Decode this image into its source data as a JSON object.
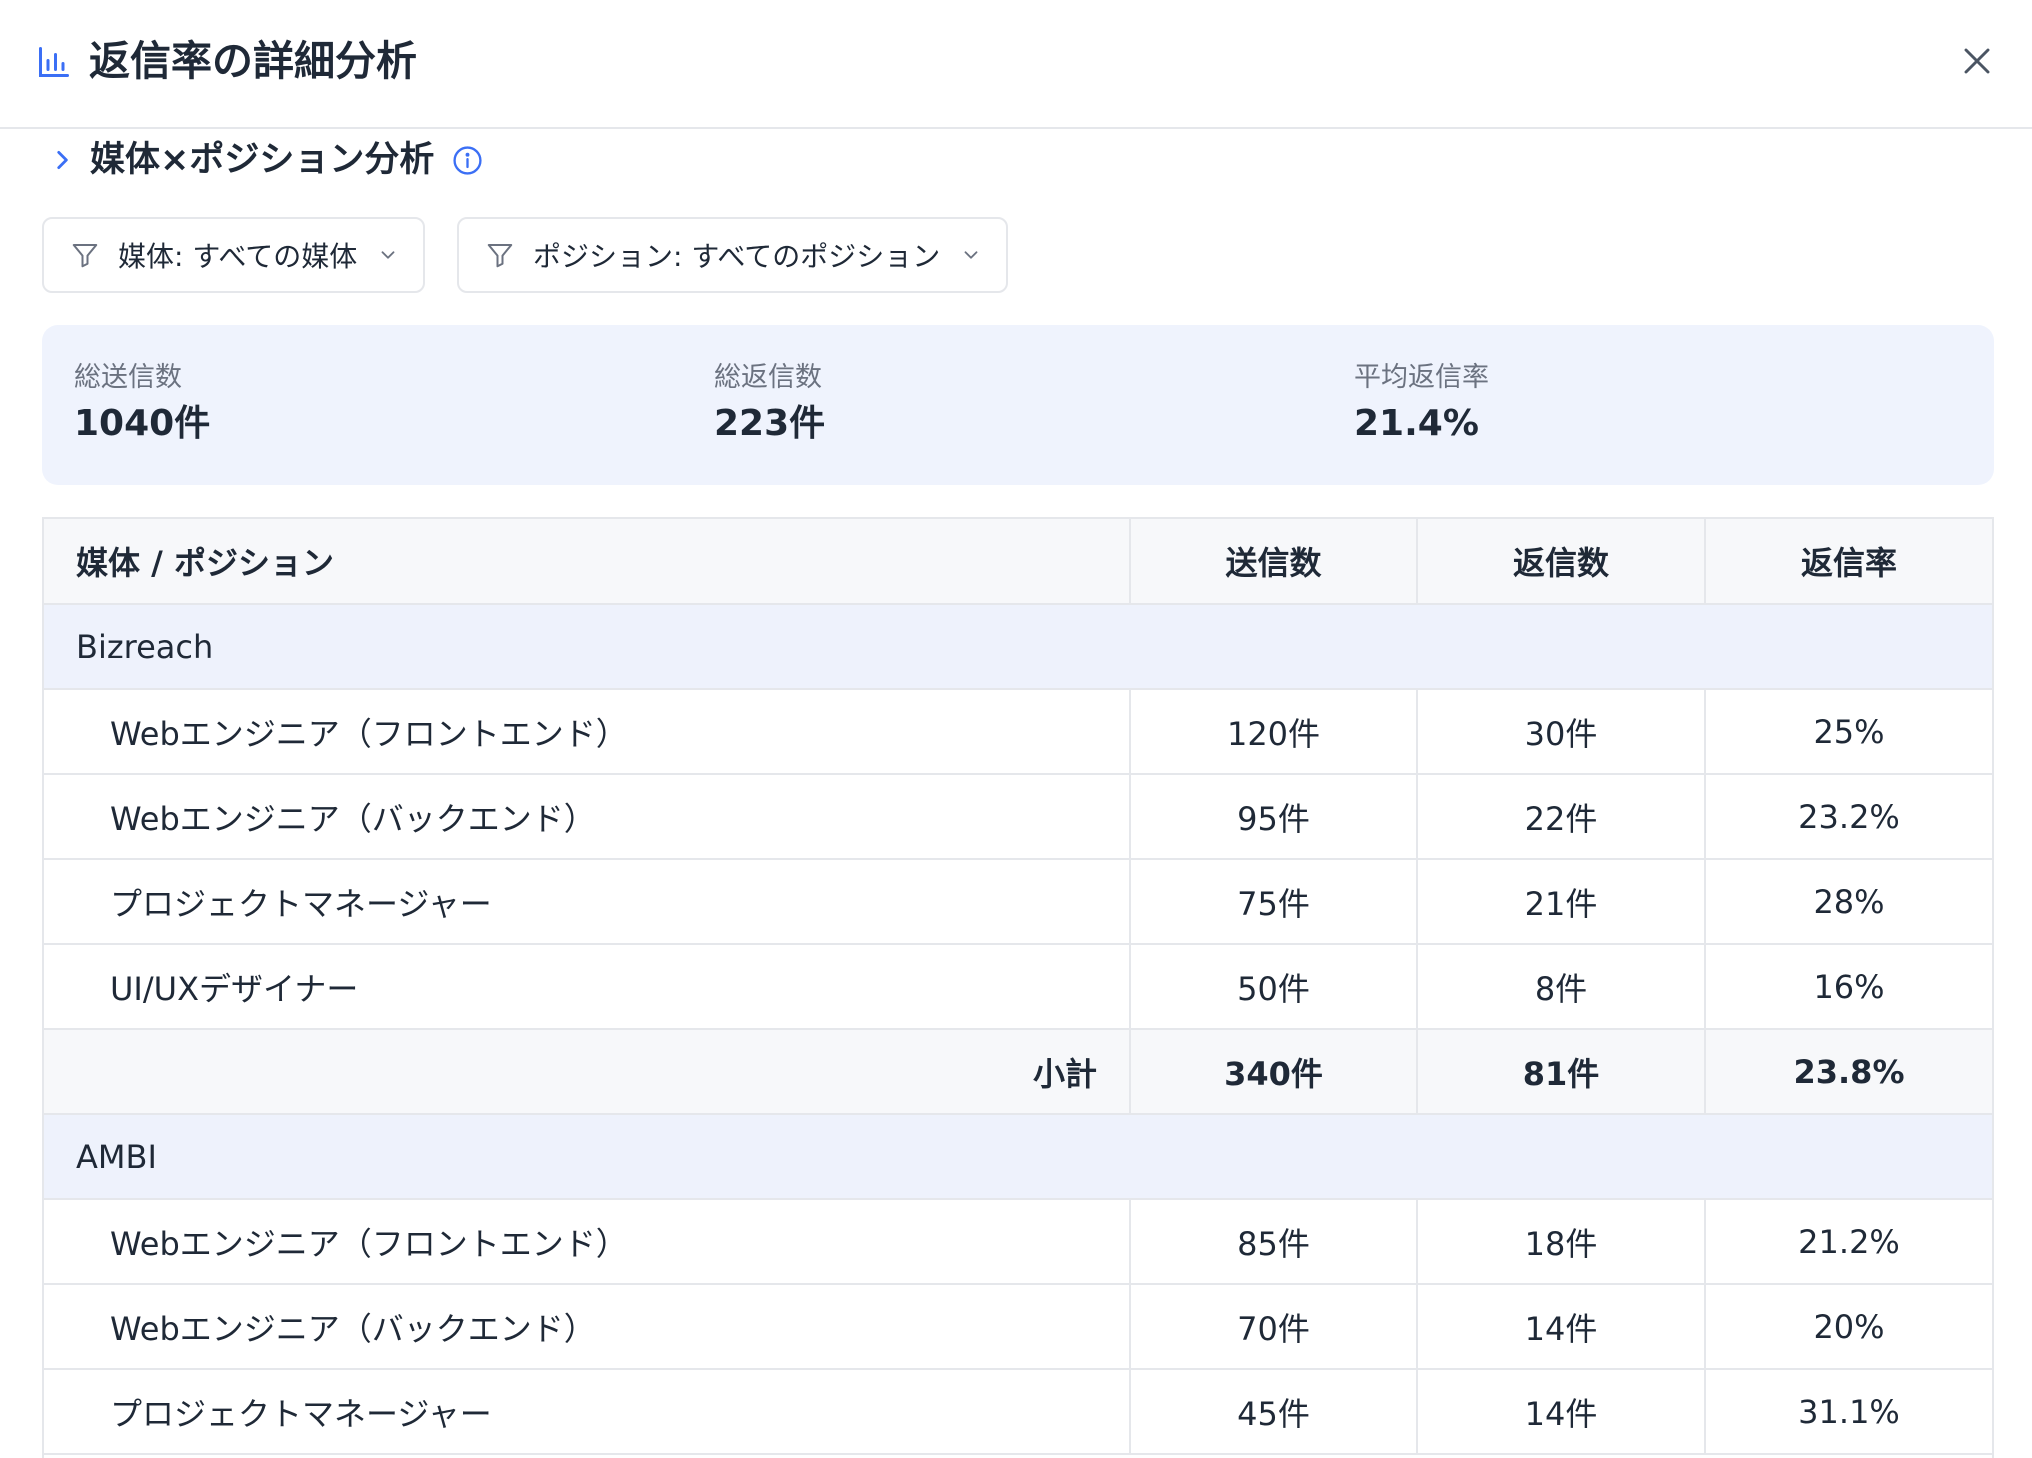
{
  "header": {
    "title": "返信率の詳細分析"
  },
  "section": {
    "title": "媒体×ポジション分析"
  },
  "filters": {
    "media": "媒体: すべての媒体",
    "position": "ポジション: すべてのポジション"
  },
  "summary": [
    {
      "label": "総送信数",
      "value": "1040件"
    },
    {
      "label": "総返信数",
      "value": "223件"
    },
    {
      "label": "平均返信率",
      "value": "21.4%"
    }
  ],
  "table": {
    "headers": [
      "媒体 / ポジション",
      "送信数",
      "返信数",
      "返信率"
    ],
    "groups": [
      {
        "name": "Bizreach",
        "rows": [
          [
            "Webエンジニア（フロントエンド）",
            "120件",
            "30件",
            "25%"
          ],
          [
            "Webエンジニア（バックエンド）",
            "95件",
            "22件",
            "23.2%"
          ],
          [
            "プロジェクトマネージャー",
            "75件",
            "21件",
            "28%"
          ],
          [
            "UI/UXデザイナー",
            "50件",
            "8件",
            "16%"
          ]
        ],
        "subtotal": [
          "小計",
          "340件",
          "81件",
          "23.8%"
        ]
      },
      {
        "name": "AMBI",
        "rows": [
          [
            "Webエンジニア（フロントエンド）",
            "85件",
            "18件",
            "21.2%"
          ],
          [
            "Webエンジニア（バックエンド）",
            "70件",
            "14件",
            "20%"
          ],
          [
            "プロジェクトマネージャー",
            "45件",
            "14件",
            "31.1%"
          ]
        ]
      }
    ]
  },
  "colors": {
    "accent": "#3b6ff5",
    "summary_bg": "#eff3fd",
    "group_bg": "#eef2fc",
    "border": "#e5e7eb"
  },
  "icons": {
    "header": "bar-chart-icon",
    "close": "close-icon",
    "section": "chevron-right-icon",
    "info": "info-icon",
    "filter": "filter-icon",
    "dropdown": "chevron-down-icon"
  }
}
